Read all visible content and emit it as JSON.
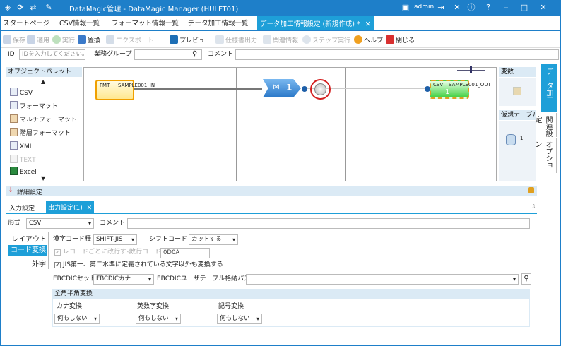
{
  "app": {
    "title": "DataMagic管理 - DataMagic Manager (HULFT01)",
    "user": ":admin"
  },
  "tabs": [
    {
      "label": "スタートページ"
    },
    {
      "label": "CSV情報一覧"
    },
    {
      "label": "フォーマット情報一覧"
    },
    {
      "label": "データ加工情報一覧"
    },
    {
      "label": "データ加工情報設定 (新規作成) *"
    }
  ],
  "toolbar": {
    "save": "保存",
    "apply": "適用",
    "run": "実行",
    "replace": "置換",
    "export": "エクスポート",
    "preview": "プレビュー",
    "spec_output": "仕様書出力",
    "related": "関連情報",
    "step_run": "ステップ実行",
    "help": "ヘルプ",
    "close": "閉じる"
  },
  "id_row": {
    "id_label": "ID",
    "id_placeholder": "IDを入力してください。",
    "group_label": "業務グループ",
    "comment_label": "コメント"
  },
  "palette": {
    "title": "オブジェクトパレット",
    "items": [
      "CSV",
      "フォーマット",
      "マルチフォーマット",
      "階層フォーマット",
      "XML",
      "TEXT",
      "Excel"
    ]
  },
  "canvas": {
    "node_in": {
      "type": "FMT",
      "name": "SAMPLE001_IN"
    },
    "node_mid": {
      "num": "1"
    },
    "node_out": {
      "type": "CSV",
      "name": "SAMPLE001_OUT",
      "num": "1"
    }
  },
  "right_panel": {
    "variables": "変数",
    "virtual_table": "仮想テーブル",
    "vt_count": "1"
  },
  "side_tabs": {
    "data_processing": "データ加工",
    "related_settings": "関連設定",
    "options": "オプション"
  },
  "detail": {
    "title": "詳細設定",
    "subtabs": [
      "入力設定",
      "出力設定(1)"
    ],
    "format_label": "形式",
    "format_value": "CSV",
    "comment_label": "コメント",
    "left_tabs": [
      "レイアウト",
      "コード変換",
      "外字"
    ],
    "kanji_label": "漢字コード種",
    "kanji_value": "SHIFT-JIS",
    "shift_label": "シフトコード",
    "shift_value": "カットする",
    "per_record_label": "レコードごとに改行する",
    "newline_label": "改行コード",
    "newline_value": "0D0A",
    "jis_label": "JIS第一、第二水準に定義されている文字以外も変換する",
    "ebcdic_label": "EBCDICセット",
    "ebcdic_value": "EBCDICカナ",
    "ebcdic_user_label": "EBCDICユーザテーブル格納パス",
    "zenkaku_title": "全角半角変換",
    "kana_label": "カナ変換",
    "kana_value": "何もしない",
    "alnum_label": "英数字変換",
    "alnum_value": "何もしない",
    "symbol_label": "記号変換",
    "symbol_value": "何もしない"
  },
  "colors": {
    "accent": "#1e7fc9",
    "tab_active": "#1e9fd8",
    "highlight_ring": "#d32020"
  }
}
